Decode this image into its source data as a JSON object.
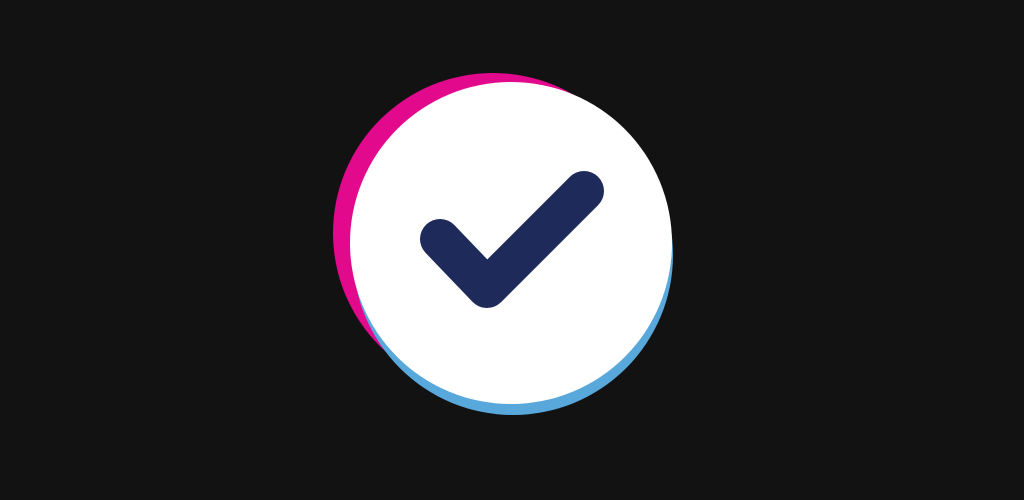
{
  "logo": {
    "icon": "checkmark-circle-icon",
    "colors": {
      "background": "#121212",
      "pink_ring": "#E2098D",
      "blue_ring": "#59A8DC",
      "circle_fill": "#FFFFFF",
      "checkmark": "#1E2A5A"
    }
  }
}
